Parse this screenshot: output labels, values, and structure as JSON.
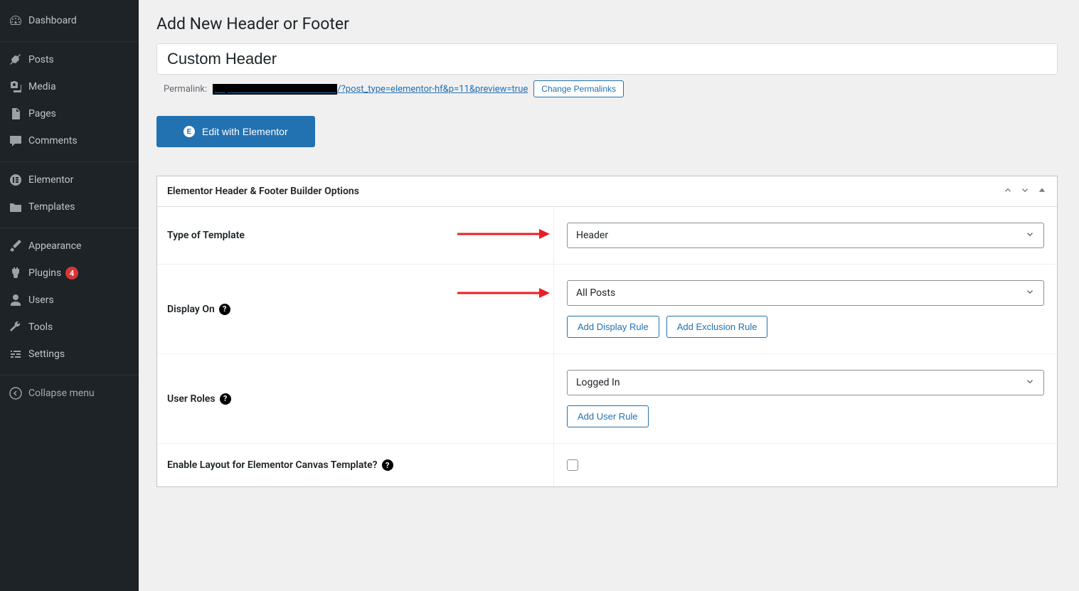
{
  "sidebar": {
    "items": [
      {
        "label": "Dashboard"
      },
      {
        "label": "Posts"
      },
      {
        "label": "Media"
      },
      {
        "label": "Pages"
      },
      {
        "label": "Comments"
      },
      {
        "label": "Elementor"
      },
      {
        "label": "Templates"
      },
      {
        "label": "Appearance"
      },
      {
        "label": "Plugins",
        "badge": "4"
      },
      {
        "label": "Users"
      },
      {
        "label": "Tools"
      },
      {
        "label": "Settings"
      },
      {
        "label": "Collapse menu"
      }
    ]
  },
  "main": {
    "page_title": "Add New Header or Footer",
    "title_value": "Custom Header",
    "permalink_label": "Permalink:",
    "permalink_path": "/?post_type=elementor-hf&p=11&preview=true",
    "change_permalinks": "Change Permalinks",
    "edit_elementor": "Edit with Elementor",
    "elementor_icon_text": "E"
  },
  "panel": {
    "title": "Elementor Header & Footer Builder Options",
    "options": {
      "template_type": {
        "label": "Type of Template",
        "value": "Header"
      },
      "display_on": {
        "label": "Display On",
        "value": "All Posts",
        "add_display": "Add Display Rule",
        "add_exclusion": "Add Exclusion Rule"
      },
      "user_roles": {
        "label": "User Roles",
        "value": "Logged In",
        "add_user": "Add User Rule"
      },
      "canvas": {
        "label": "Enable Layout for Elementor Canvas Template?"
      }
    }
  }
}
